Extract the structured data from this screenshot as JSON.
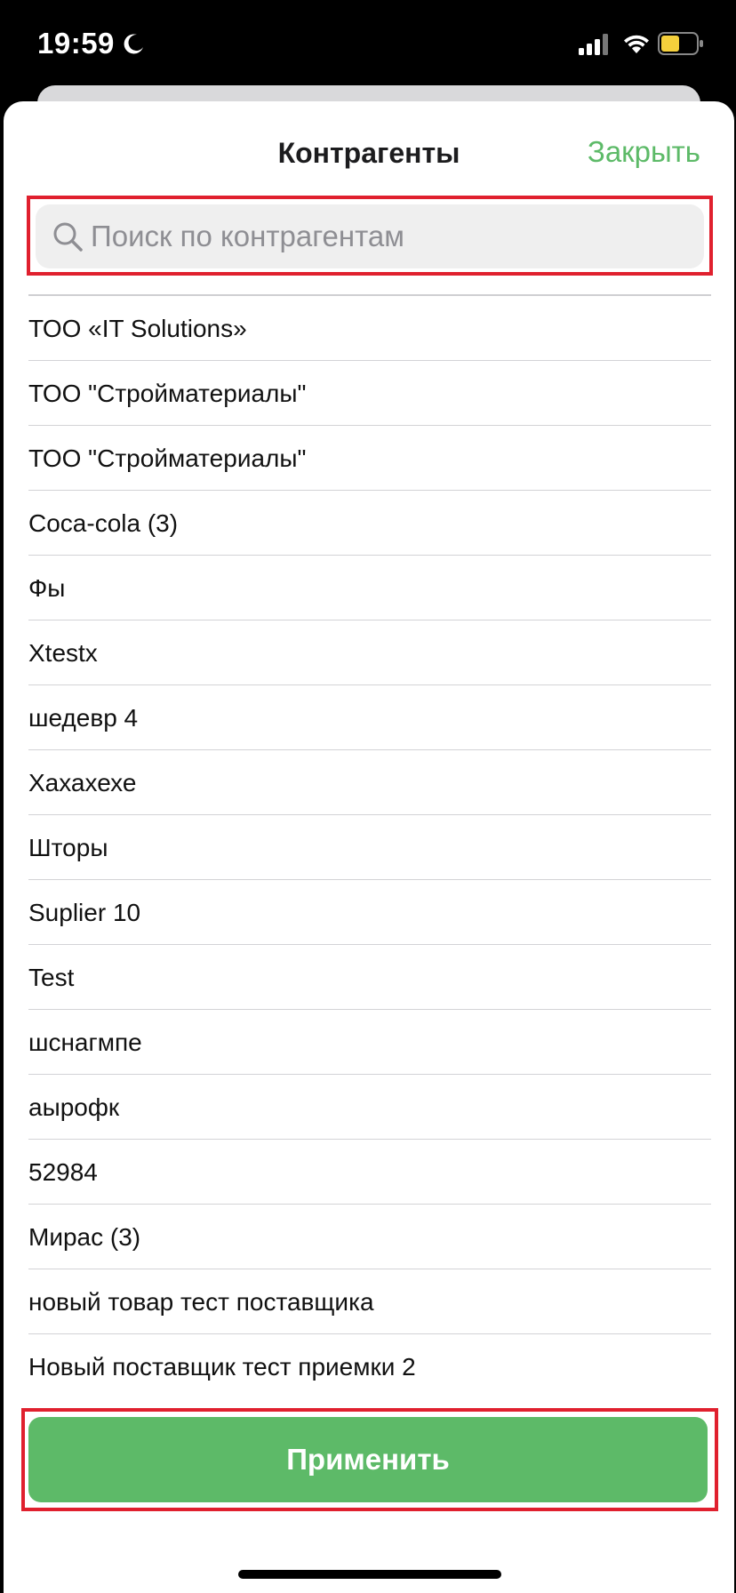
{
  "status_bar": {
    "time": "19:59",
    "icons": [
      "moon-icon",
      "signal-icon",
      "wifi-icon",
      "battery-icon"
    ],
    "battery_color": "#f5d03c"
  },
  "header": {
    "title": "Контрагенты",
    "close_label": "Закрыть"
  },
  "search": {
    "placeholder": "Поиск по контрагентам",
    "value": ""
  },
  "counterparties": [
    "ТОО «IT Solutions»",
    "ТОО \"Стройматериалы\"",
    "ТОО \"Стройматериалы\"",
    "Coca-cola (3)",
    "Фы",
    "Xtestx",
    "шедевр 4",
    "Хахахехе",
    "Шторы",
    "Suplier 10",
    "Test",
    "шснагмпе",
    "аырофк",
    "52984",
    "Мирас (3)",
    "новый товар тест поставщика",
    "Новый поставщик тест приемки 2"
  ],
  "footer": {
    "apply_label": "Применить"
  },
  "colors": {
    "accent": "#5dba68",
    "highlight": "#e0202e"
  }
}
